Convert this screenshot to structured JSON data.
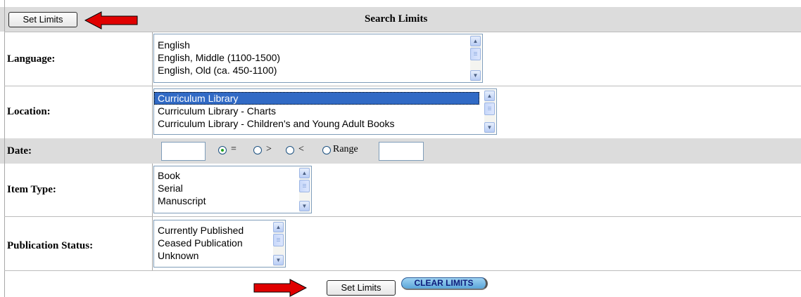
{
  "header": {
    "set_limits_label": "Set Limits",
    "title": "Search Limits"
  },
  "language": {
    "label": "Language:",
    "options": [
      "English",
      "English, Middle (1100-1500)",
      "English, Old (ca. 450-1100)"
    ]
  },
  "location": {
    "label": "Location:",
    "options": [
      "Curriculum Library",
      "Curriculum Library - Charts",
      "Curriculum Library - Children's and Young Adult Books"
    ],
    "selected": "Curriculum Library"
  },
  "date": {
    "label": "Date:",
    "from_value": "",
    "to_value": "",
    "operators": [
      "=",
      ">",
      "<",
      "Range"
    ],
    "selected_operator": "="
  },
  "item_type": {
    "label": "Item Type:",
    "options": [
      "Book",
      "Serial",
      "Manuscript"
    ]
  },
  "publication_status": {
    "label": "Publication Status:",
    "options": [
      "Currently Published",
      "Ceased Publication",
      "Unknown"
    ]
  },
  "footer": {
    "set_limits_label": "Set Limits",
    "clear_limits_label": "CLEAR LIMITS"
  },
  "colors": {
    "arrow": "#e00000",
    "row_shade": "#dcdcdc",
    "selection": "#316ac5"
  }
}
